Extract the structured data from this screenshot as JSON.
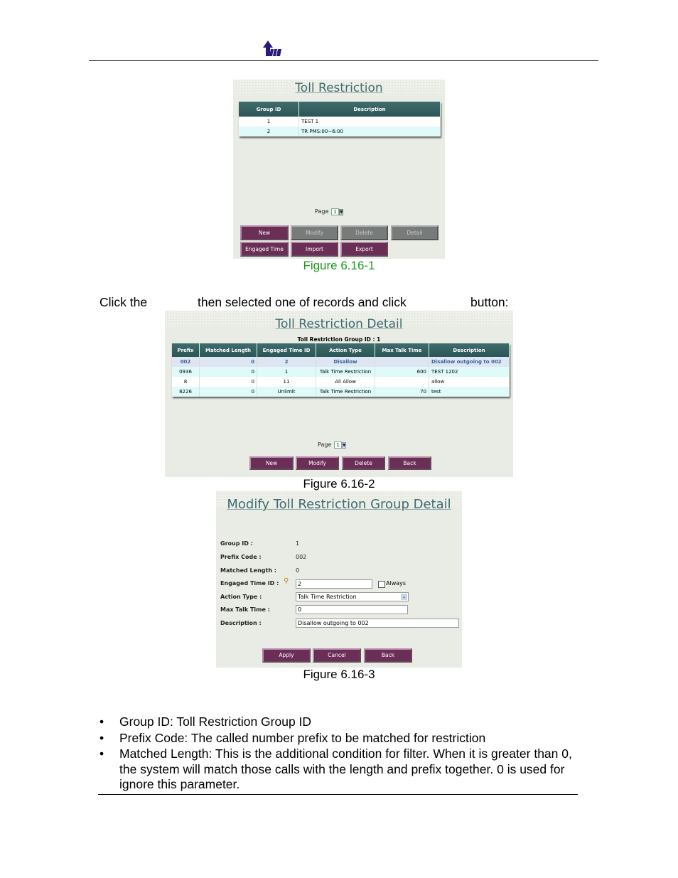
{
  "logo": {
    "text": "TW",
    "color": "#2a1a7a"
  },
  "fig1": {
    "title": "Toll Restriction",
    "columns": [
      "Group ID",
      "Description"
    ],
    "rows": [
      [
        "1",
        "TEST 1"
      ],
      [
        "2",
        "TR PMS:00~6:00"
      ]
    ],
    "page_label": "Page",
    "page_value": "1",
    "buttons": {
      "new": "New",
      "modify": "Modify",
      "delete": "Delete",
      "detail": "Detail",
      "engaged_time": "Engaged Time",
      "import": "Import",
      "export": "Export"
    },
    "caption": "Figure 6.16-1"
  },
  "instruction": {
    "part1": "Click the",
    "part2": "then selected one of records and click",
    "part3": "button:"
  },
  "fig2": {
    "title": "Toll Restriction Detail",
    "subtitle": "Toll Restriction Group ID : 1",
    "columns": [
      "Prefix",
      "Matched Length",
      "Engaged Time ID",
      "Action Type",
      "Max Talk Time",
      "Description"
    ],
    "rows": [
      [
        "002",
        "0",
        "2",
        "Disallow",
        "",
        "Disallow outgoing to 002"
      ],
      [
        "0936",
        "0",
        "1",
        "Talk Time Restriction",
        "600",
        "TEST 1202"
      ],
      [
        "8",
        "0",
        "11",
        "All Allow",
        "",
        "allow"
      ],
      [
        "8226",
        "0",
        "Unlimit",
        "Talk Time Restriction",
        "70",
        "test"
      ]
    ],
    "page_label": "Page",
    "page_value": "1",
    "buttons": {
      "new": "New",
      "modify": "Modify",
      "delete": "Delete",
      "back": "Back"
    },
    "caption": "Figure 6.16-2"
  },
  "fig3": {
    "title": "Modify Toll Restriction Group Detail",
    "group_id_label": "Group ID :",
    "group_id": "1",
    "prefix_label": "Prefix Code :",
    "prefix": "002",
    "matched_label": "Matched Length :",
    "matched": "0",
    "engaged_label": "Engaged Time ID :",
    "engaged": "2",
    "always_label": "Always",
    "action_label": "Action Type :",
    "action": "Talk Time Restriction",
    "max_label": "Max Talk Time :",
    "max": "0",
    "desc_label": "Description :",
    "desc": "Disallow outgoing to 002",
    "buttons": {
      "apply": "Apply",
      "cancel": "Cancel",
      "back": "Back"
    },
    "caption": "Figure 6.16-3"
  },
  "bullets": [
    "Group ID: Toll Restriction Group ID",
    "Prefix Code: The called number prefix to be matched for restriction",
    "Matched Length: This is the additional condition for filter. When it is greater than 0, the system will match those calls with the length and prefix together. 0 is used for ignore this parameter."
  ],
  "colors": {
    "caption_green": "#1a9a1a",
    "header_teal": "#2c5556",
    "button_purple": "#6a2e57",
    "title_teal": "#3f6b70"
  }
}
